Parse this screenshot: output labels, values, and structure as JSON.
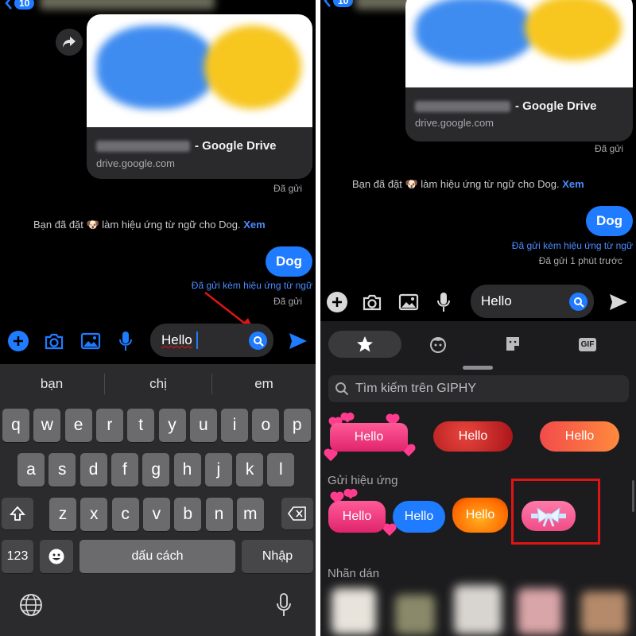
{
  "left": {
    "status_badge": "10",
    "link_card": {
      "title_suffix": "- Google Drive",
      "url": "drive.google.com"
    },
    "sent_status_1": "Đã gửi",
    "notice": {
      "text": "Bạn đã đặt 🐶 làm hiệu ứng từ ngữ cho Dog.",
      "link": "Xem"
    },
    "message_bubble": "Dog",
    "effect_link": "Đã gửi kèm hiệu ứng từ ngữ",
    "sent_status_2": "Đã gửi",
    "input_value": "Hello",
    "keyboard": {
      "suggestions": [
        "bạn",
        "chị",
        "em"
      ],
      "row1": [
        "q",
        "w",
        "e",
        "r",
        "t",
        "y",
        "u",
        "i",
        "o",
        "p"
      ],
      "row2": [
        "a",
        "s",
        "d",
        "f",
        "g",
        "h",
        "j",
        "k",
        "l"
      ],
      "row3": [
        "z",
        "x",
        "c",
        "v",
        "b",
        "n",
        "m"
      ],
      "numbers_key": "123",
      "space_key": "dấu cách",
      "return_key": "Nhập"
    }
  },
  "right": {
    "status_badge": "10",
    "link_card": {
      "title_suffix": "- Google Drive",
      "url": "drive.google.com"
    },
    "sent_status_1": "Đã gửi",
    "notice": {
      "text": "Bạn đã đặt 🐶 làm hiệu ứng từ ngữ cho Dog.",
      "link": "Xem"
    },
    "message_bubble": "Dog",
    "effect_link": "Đã gửi kèm hiệu ứng từ ngữ",
    "sent_status_2": "Đã gửi 1 phút trước",
    "input_value": "Hello",
    "sticker_tabs": [
      "star-icon",
      "avatar-icon",
      "sticker-icon",
      "GIF"
    ],
    "giphy_placeholder": "Tìm kiếm trên GIPHY",
    "giphy_results": [
      "Hello",
      "Hello",
      "Hello"
    ],
    "effects_section_title": "Gửi hiệu ứng",
    "effects": [
      "Hello",
      "Hello",
      "Hello",
      ""
    ],
    "stickers_section_title": "Nhãn dán"
  },
  "colors": {
    "accent": "#1f7bff",
    "highlight_box": "#e01414",
    "arrow": "#e01414"
  }
}
